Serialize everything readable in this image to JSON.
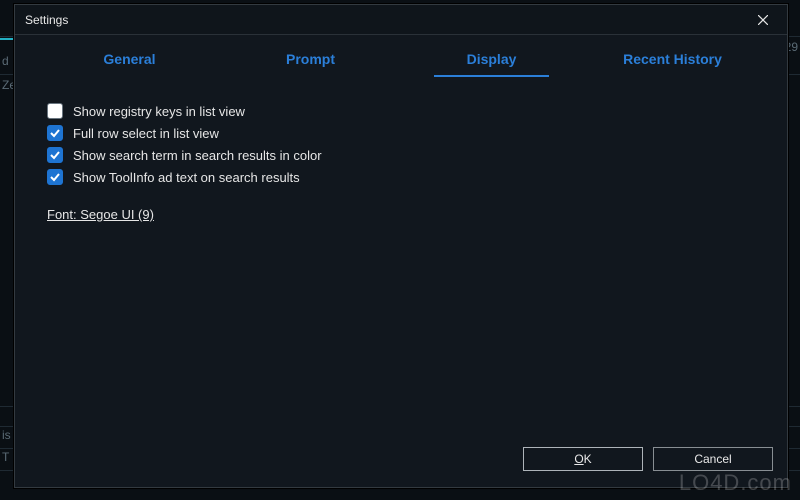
{
  "dialog": {
    "title": "Settings"
  },
  "tabs": {
    "general": "General",
    "prompt": "Prompt",
    "display": "Display",
    "recent_history": "Recent History",
    "active": "display"
  },
  "options": {
    "show_registry_keys": {
      "label": "Show registry keys in list view",
      "checked": false
    },
    "full_row_select": {
      "label": "Full row select in list view",
      "checked": true
    },
    "show_search_term": {
      "label": "Show search term in search results in color",
      "checked": true
    },
    "show_toolinfo": {
      "label": "Show ToolInfo ad text on search results",
      "checked": true
    }
  },
  "font_link": "Font: Segoe UI (9)",
  "buttons": {
    "ok_prefix": "O",
    "ok_rest": "K",
    "cancel": "Cancel"
  },
  "watermark": "LO4D.com",
  "bg": {
    "cell_right": "29",
    "cell_left1": "d",
    "cell_left2": "Ze",
    "cell_bottom1": "is",
    "cell_bottom2": "T"
  }
}
